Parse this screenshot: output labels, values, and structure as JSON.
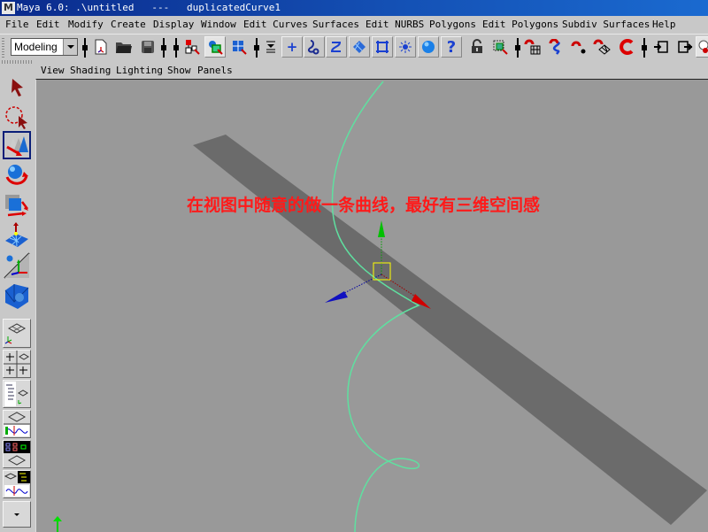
{
  "window": {
    "app_icon": "maya-logo-icon",
    "title": "Maya 6.0: .\\untitled   ---   duplicatedCurve1"
  },
  "menubar": {
    "items": [
      "File",
      "Edit",
      "Modify",
      "Create",
      "Display",
      "Window",
      "Edit Curves",
      "Surfaces",
      "Edit NURBS",
      "Polygons",
      "Edit Polygons",
      "Subdiv Surfaces",
      "Help"
    ]
  },
  "toolbar": {
    "mode_selector": {
      "selected": "Modeling"
    },
    "icons": [
      "new-scene-icon",
      "open-scene-icon",
      "save-scene-icon",
      "select-by-hierarchy-icon",
      "select-by-object-type-icon",
      "select-by-component-type-icon",
      "selection-mask-menu-icon",
      "snap-to-grid-icon-plus",
      "snap-to-curves-icon",
      "snap-to-points-icon",
      "snap-to-view-planes-icon",
      "snap-to-grid-frame-icon",
      "make-live-icon",
      "sphere-icon",
      "help-question-icon",
      "lock-icon",
      "select-highlight-icon",
      "snap-grid-magnet-icon",
      "snap-curve-magnet-icon",
      "snap-point-magnet-icon",
      "snap-plane-magnet-icon",
      "live-magnet-icon",
      "input-ops-icon",
      "output-ops-icon",
      "render-icon"
    ]
  },
  "panel_menu": {
    "items": [
      "View",
      "Shading",
      "Lighting",
      "Show",
      "Panels"
    ]
  },
  "toolbox": {
    "tools": [
      "select-tool-icon",
      "lasso-tool-icon",
      "move-tool-icon",
      "rotate-tool-icon",
      "scale-tool-icon",
      "manipulator-tool-icon",
      "soft-mod-tool-icon",
      "last-tool-icon"
    ],
    "active_tool": "move-tool-icon",
    "layouts": [
      "single-perspective-layout",
      "four-view-layout",
      "outliner-perspective-layout",
      "perspective-graph-layout",
      "hypergraph-perspective-layout",
      "persp-outliner-graph-layout"
    ],
    "more_button": "chevron-down-icon"
  },
  "viewport": {
    "background": "#999999",
    "plane_color": "#6b6b6b",
    "curve_color": "#5fe0a0",
    "caption": "在视图中随意的做一条曲线，最好有三维空间感",
    "caption_color": "#ff1a1a"
  }
}
